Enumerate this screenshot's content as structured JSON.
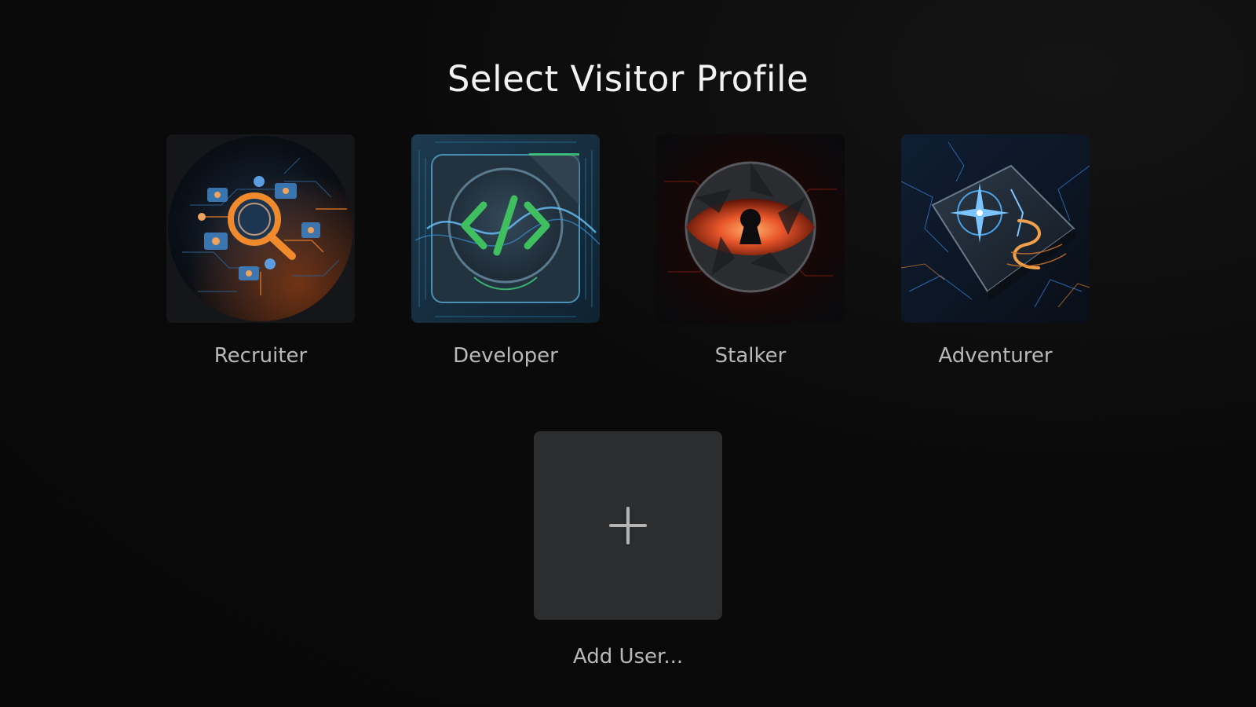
{
  "page": {
    "title": "Select Visitor Profile"
  },
  "profiles": [
    {
      "label": "Recruiter",
      "icon": "magnifier-network-icon",
      "accent": "#f08a2c"
    },
    {
      "label": "Developer",
      "icon": "code-brackets-icon",
      "accent": "#3fbf5f"
    },
    {
      "label": "Stalker",
      "icon": "eye-keyhole-icon",
      "accent": "#e8552a"
    },
    {
      "label": "Adventurer",
      "icon": "compass-map-icon",
      "accent": "#4aa3e8"
    }
  ],
  "add_user": {
    "label": "Add User...",
    "icon": "plus-icon"
  },
  "colors": {
    "background": "#0a0a0a",
    "title_text": "#f2f2f2",
    "label_text": "#b9b9b9",
    "add_tile": "#2b2d2f"
  }
}
